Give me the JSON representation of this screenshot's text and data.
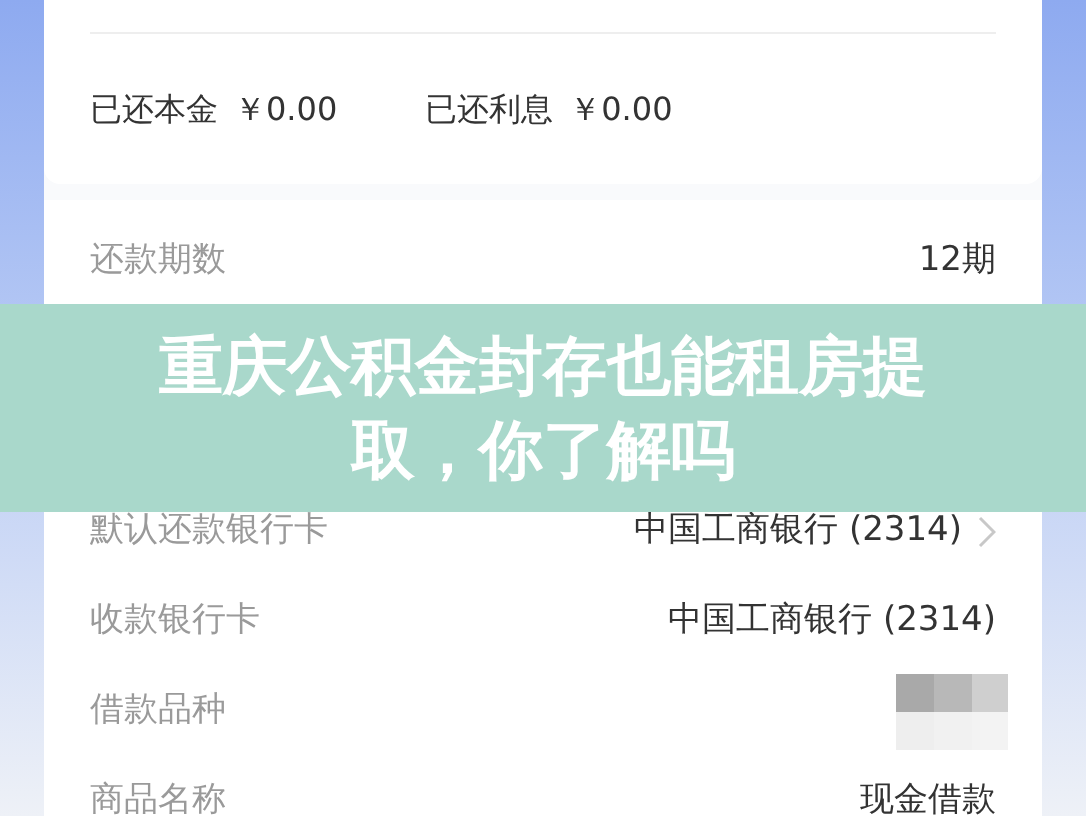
{
  "summary": [
    {
      "label": "已还本金",
      "amount": "￥0.00"
    },
    {
      "label": "已还利息",
      "amount": "￥0.00"
    }
  ],
  "rows_above": [
    {
      "kind": "text",
      "label": "还款期数",
      "value": "12期"
    }
  ],
  "banner": {
    "title": "重庆公积金封存也能租房提取，你了解吗"
  },
  "rows_below": [
    {
      "kind": "chevron",
      "label": "默认还款银行卡",
      "value": "中国工商银行 (2314)"
    },
    {
      "kind": "text",
      "label": "收款银行卡",
      "value": "中国工商银行 (2314)"
    },
    {
      "kind": "hidden",
      "label": "借款品种"
    },
    {
      "kind": "text",
      "label": "商品名称",
      "value": "现金借款"
    }
  ]
}
